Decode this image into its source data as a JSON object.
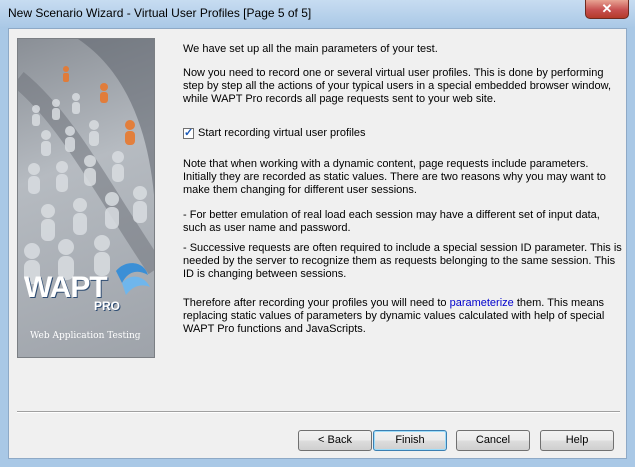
{
  "window": {
    "title": "New Scenario Wizard - Virtual User Profiles [Page 5 of 5]",
    "close_label": "✕"
  },
  "side_panel": {
    "logo_text": "WAPT",
    "logo_pro": "PRO",
    "logo_subtitle": "Web Application Testing"
  },
  "content": {
    "p1": "We have set up all the main parameters of your test.",
    "p2": "Now you need to record one or several virtual user profiles. This is done by performing step by step all the actions of your typical users in a special embedded browser window, while WAPT Pro records all page requests sent to your web site.",
    "checkbox_label": "Start recording virtual user profiles",
    "checkbox_checked": true,
    "p3": "Note that when working with a dynamic content, page requests include parameters. Initially they are recorded as static values. There are two reasons why you may want to make them changing for different user sessions.",
    "p4": "- For better emulation of real load each session may have a different set of input data, such as user name and password.",
    "p5": "- Successive requests are often required to include a special session ID parameter. This is needed by the server to recognize them as requests belonging to the same session. This ID is changing between sessions.",
    "p6_before": "Therefore after recording your profiles you will need to ",
    "p6_link": "parameterize",
    "p6_after": " them. This means replacing static values of parameters by dynamic values calculated with help of special WAPT Pro functions and JavaScripts."
  },
  "buttons": {
    "back": "< Back",
    "finish": "Finish",
    "cancel": "Cancel",
    "help": "Help"
  },
  "colors": {
    "frame": "#a9c8e6",
    "link": "#0000cc",
    "close": "#c75050"
  }
}
